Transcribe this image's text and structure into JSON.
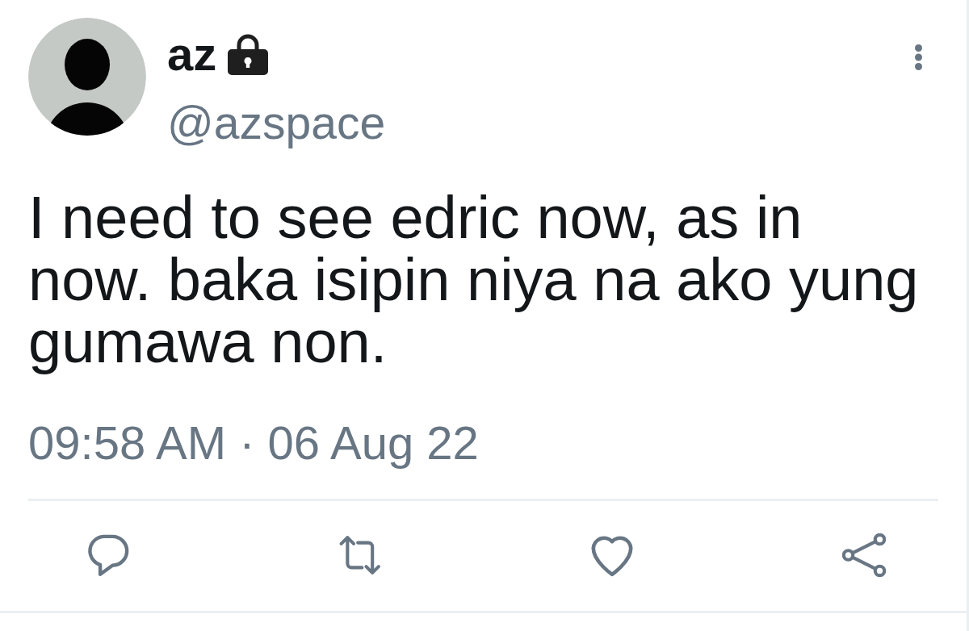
{
  "author": {
    "name": "az",
    "protected": true,
    "handle": "@azspace"
  },
  "tweet": {
    "text": "I need to see edric now, as in now. baka isipin niya na ako yung gumawa non.",
    "timestamp": "09:58 AM · 06 Aug 22"
  },
  "actions": [
    {
      "kind": "reply"
    },
    {
      "kind": "retweet"
    },
    {
      "kind": "like"
    },
    {
      "kind": "share"
    }
  ]
}
